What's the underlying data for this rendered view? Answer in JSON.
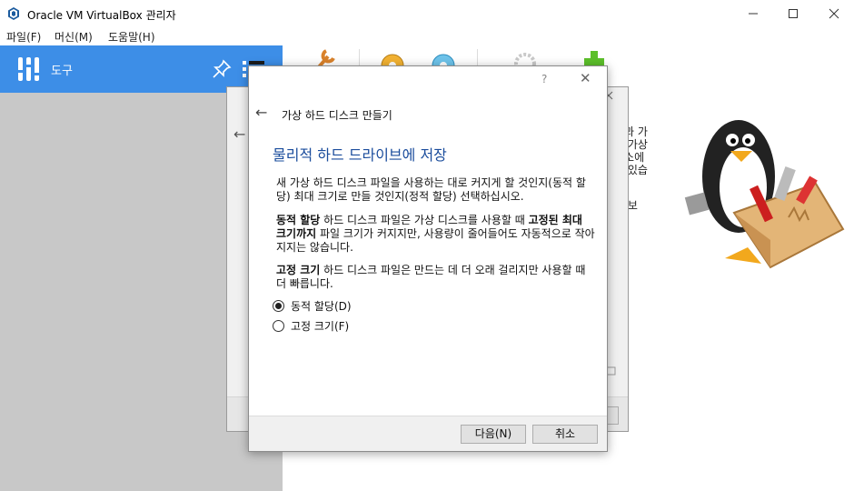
{
  "window": {
    "title": "Oracle VM VirtualBox 관리자"
  },
  "menu": [
    "파일(F)",
    "머신(M)",
    "도움말(H)"
  ],
  "sidebar": {
    "tools_label": "도구"
  },
  "welcome_fragments": [
    "인과 가",
    "는 가상",
    "요소에",
    "수 있습",
    "를 보",
    "다",
    "설"
  ],
  "back_wizard": {
    "back_arrow": "←"
  },
  "wizard": {
    "help": "?",
    "close": "✕",
    "back_arrow": "←",
    "title": "가상 하드 디스크 만들기",
    "heading": "물리적 하드 드라이브에 저장",
    "intro": "새 가상 하드 디스크 파일을 사용하는 대로 커지게 할 것인지(동적 할당) 최대 크기로 만들 것인지(정적 할당) 선택하십시오.",
    "dynamic_bold1": "동적 할당",
    "dynamic_text1": " 하드 디스크 파일은 가상 디스크를 사용할 때 ",
    "dynamic_bold2": "고정된 최대 크기까지",
    "dynamic_text2": " 파일 크기가 커지지만, 사용량이 줄어들어도 자동적으로 작아지지는 않습니다.",
    "fixed_bold": "고정 크기",
    "fixed_text": " 하드 디스크 파일은 만드는 데 더 오래 걸리지만 사용할 때 더 빠릅니다.",
    "options": [
      {
        "label": "동적 할당(D)",
        "checked": true
      },
      {
        "label": "고정 크기(F)",
        "checked": false
      }
    ],
    "next_button": "다음(N)",
    "cancel_button": "취소"
  }
}
